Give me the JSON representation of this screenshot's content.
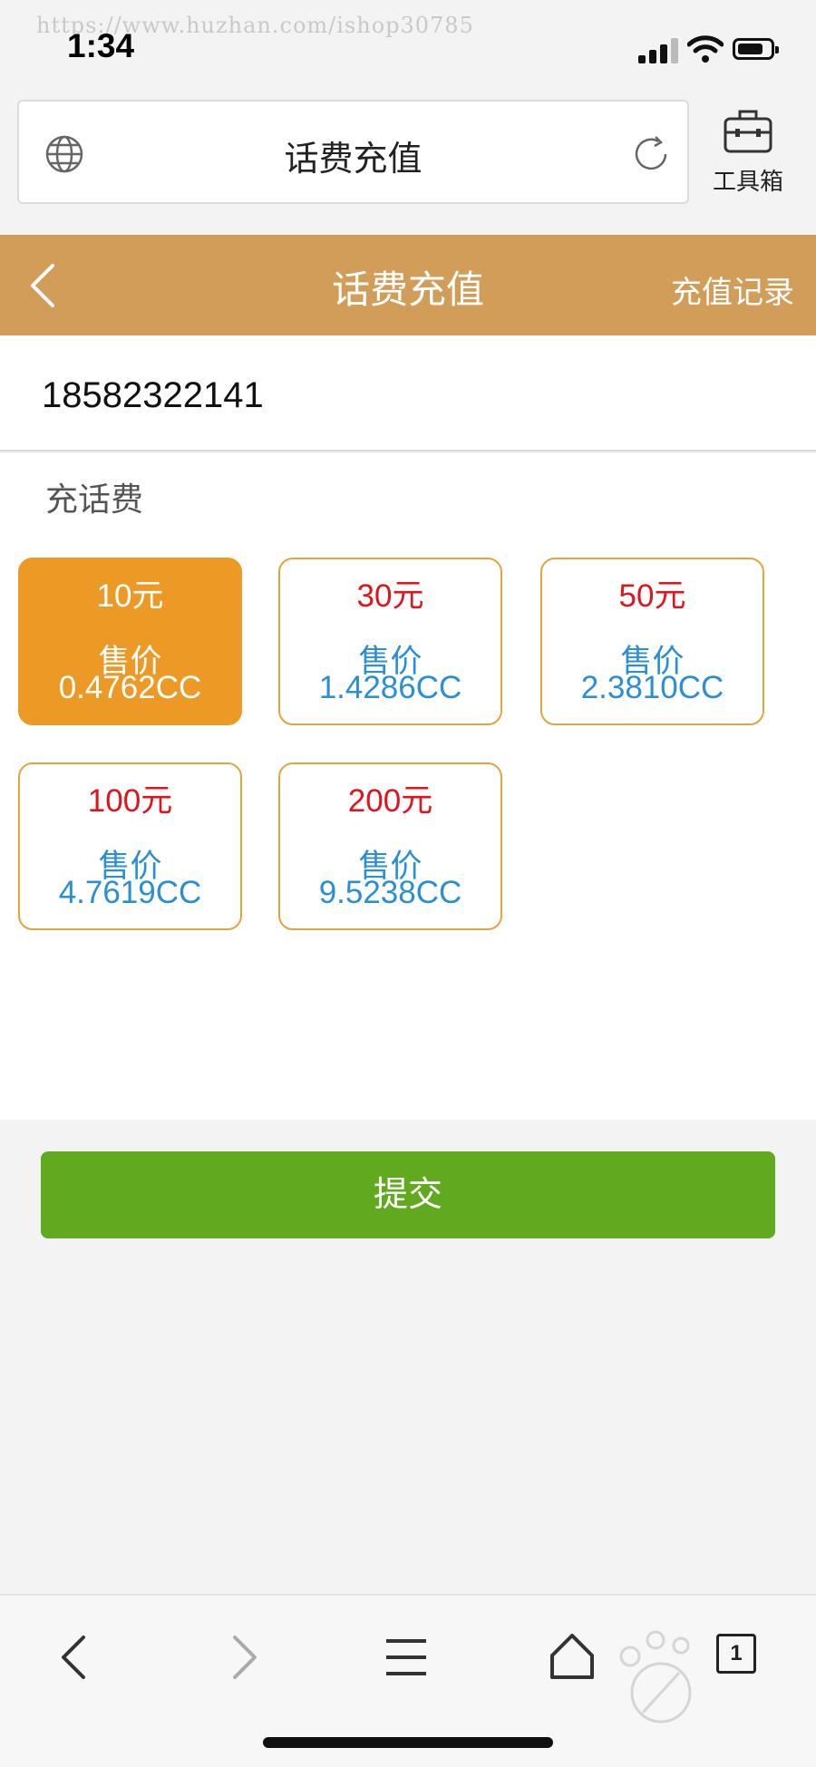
{
  "status_bar": {
    "watermark": "https://www.huzhan.com/ishop30785",
    "time": "1:34"
  },
  "browser": {
    "address_title": "话费充值",
    "toolbox_label": "工具箱"
  },
  "header": {
    "title": "话费充值",
    "records_link": "充值记录"
  },
  "form": {
    "phone_number": "18582322141",
    "section_label": "充话费",
    "options": [
      {
        "amount": "10元",
        "price_label": "售价",
        "price_value": "0.4762CC",
        "selected": true
      },
      {
        "amount": "30元",
        "price_label": "售价",
        "price_value": "1.4286CC",
        "selected": false
      },
      {
        "amount": "50元",
        "price_label": "售价",
        "price_value": "2.3810CC",
        "selected": false
      },
      {
        "amount": "100元",
        "price_label": "售价",
        "price_value": "4.7619CC",
        "selected": false
      },
      {
        "amount": "200元",
        "price_label": "售价",
        "price_value": "9.5238CC",
        "selected": false
      }
    ],
    "submit_label": "提交"
  },
  "bottom_nav": {
    "tab_count": "1",
    "icons": [
      "back-icon",
      "forward-icon",
      "menu-icon",
      "home-icon",
      "tabs-icon"
    ]
  },
  "colors": {
    "header_bg": "#d19d58",
    "selected_option_bg": "#ec9a25",
    "option_border": "#e3a43b",
    "amount_text": "#e0141b",
    "price_text": "#2b8fd6",
    "submit_bg": "#61aa1f"
  }
}
